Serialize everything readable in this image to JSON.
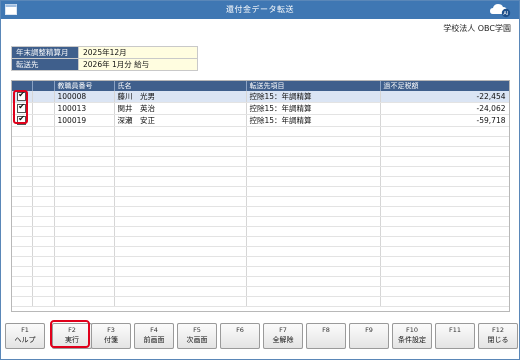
{
  "window": {
    "title": "還付金データ転送"
  },
  "header": {
    "company": "学校法人 OBC学園"
  },
  "info": [
    {
      "label": "年末調整精算月",
      "value": "2025年12月"
    },
    {
      "label": "転送先",
      "value": "2026年 1月分 給与"
    }
  ],
  "grid": {
    "columns": [
      "",
      "",
      "教職員番号",
      "氏名",
      "転送先項目",
      "過不足税額"
    ],
    "rows": [
      {
        "checked": true,
        "id": "100008",
        "name": "藤川　光男",
        "item": "控除15：年調精算",
        "amount": "-22,454"
      },
      {
        "checked": true,
        "id": "100013",
        "name": "関井　英治",
        "item": "控除15：年調精算",
        "amount": "-24,062"
      },
      {
        "checked": true,
        "id": "100019",
        "name": "深瀬　安正",
        "item": "控除15：年調精算",
        "amount": "-59,718"
      }
    ]
  },
  "fkeys": [
    {
      "key": "F1",
      "label": "ヘルプ"
    },
    {
      "key": "F2",
      "label": "実行"
    },
    {
      "key": "F3",
      "label": "付箋"
    },
    {
      "key": "F4",
      "label": "前画面"
    },
    {
      "key": "F5",
      "label": "次画面"
    },
    {
      "key": "F6",
      "label": ""
    },
    {
      "key": "F7",
      "label": "全解除"
    },
    {
      "key": "F8",
      "label": ""
    },
    {
      "key": "F9",
      "label": ""
    },
    {
      "key": "F10",
      "label": "条件設定"
    },
    {
      "key": "F11",
      "label": ""
    },
    {
      "key": "F12",
      "label": "閉じる"
    }
  ],
  "colors": {
    "titlebar": "#3f77b3",
    "header_cell": "#3f5f8c",
    "highlight": "#e0001b",
    "selected_row": "#dbe5f4"
  }
}
